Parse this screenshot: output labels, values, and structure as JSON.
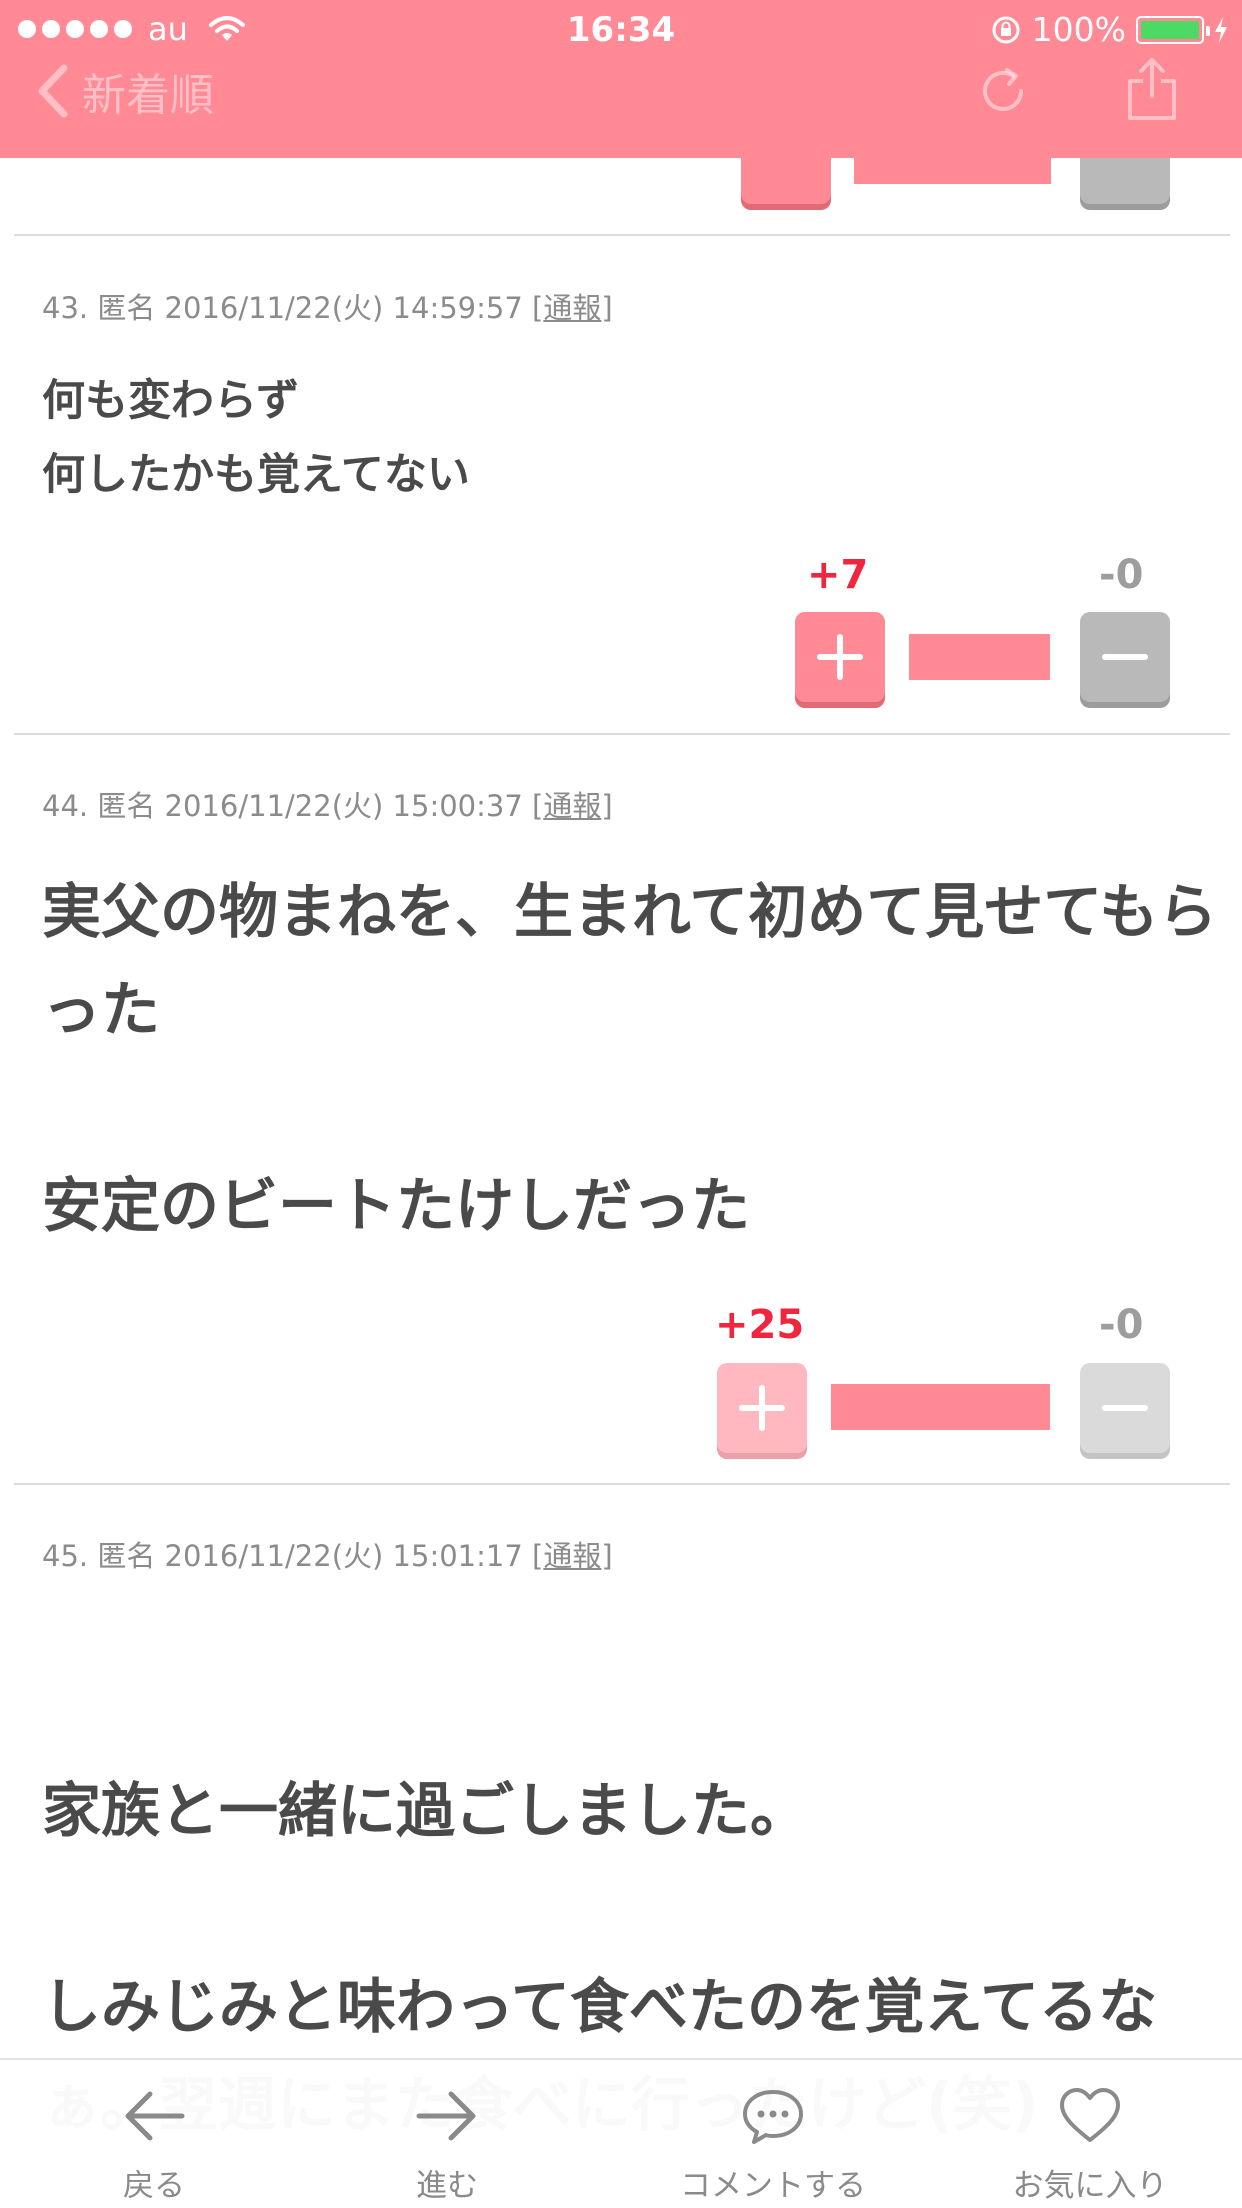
{
  "status": {
    "carrier": "au",
    "time": "16:34",
    "battery": "100%",
    "battery_level": 1.0,
    "battery_color": "#4cd964"
  },
  "nav": {
    "back_label": "新着順",
    "icons": [
      "chevron-left-icon",
      "refresh-icon",
      "share-icon"
    ]
  },
  "accent_color": "#ff8a95",
  "vote_plus_color": "#f0263f",
  "comments": [
    {
      "meta": "43. 匿名 2016/11/22(火) 14:59:57 [",
      "report": "通報",
      "meta_end": "]",
      "body": "何も変わらず\n何したかも覚えてない",
      "plus": "+7",
      "minus": "-0"
    },
    {
      "meta": "44. 匿名 2016/11/22(火) 15:00:37 [",
      "report": "通報",
      "meta_end": "]",
      "body": "実父の物まねを、生まれて初めて見せてもらった\n\n安定のビートたけしだった",
      "plus": "+25",
      "minus": "-0"
    },
    {
      "meta": "45. 匿名 2016/11/22(火) 15:01:17 [",
      "report": "通報",
      "meta_end": "]",
      "body": "\n家族と一緒に過ごしました。\n\nしみじみと味わって食べたのを覚えてるなぁ。翌週にまた食べに行ったけど(笑)"
    }
  ],
  "tabbar": [
    {
      "label": "戻る",
      "icon": "arrow-left-icon"
    },
    {
      "label": "進む",
      "icon": "arrow-right-icon"
    },
    {
      "label": "コメントする",
      "icon": "speech-bubble-icon"
    },
    {
      "label": "お気に入り",
      "icon": "heart-icon"
    }
  ]
}
